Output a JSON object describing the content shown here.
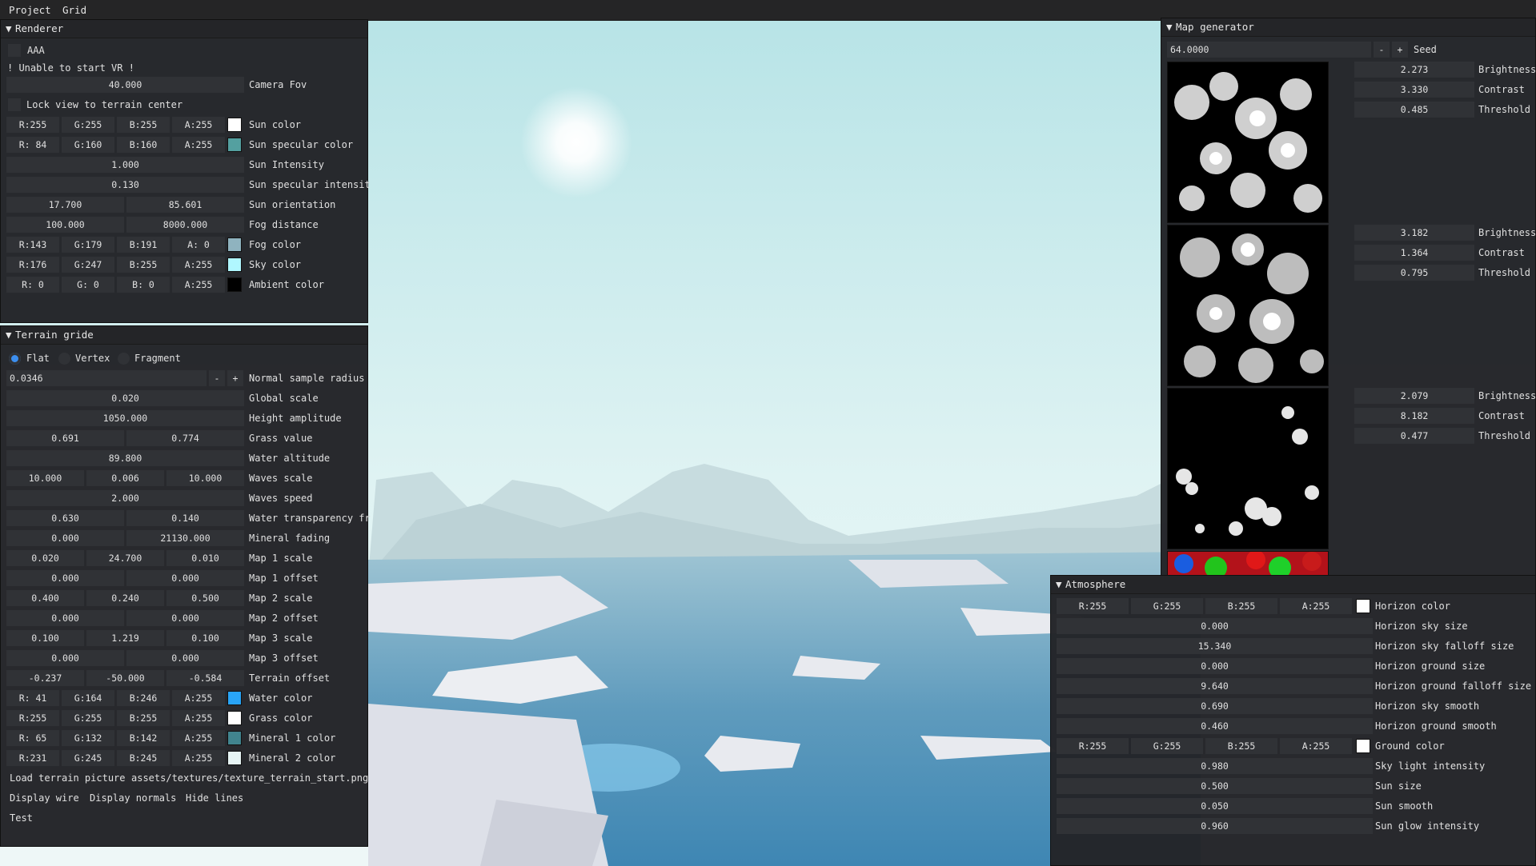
{
  "menu": {
    "items": [
      "Project",
      "Grid"
    ]
  },
  "renderer": {
    "title": "Renderer",
    "aa_label": "AAA",
    "vr_warning": "! Unable to start VR !",
    "camera_fov": {
      "value": "40.000",
      "label": "Camera Fov"
    },
    "lock_view_label": "Lock view to terrain center",
    "sun_color": {
      "r": "R:255",
      "g": "G:255",
      "b": "B:255",
      "a": "A:255",
      "label": "Sun color",
      "hex": "#ffffff"
    },
    "sun_specular_color": {
      "r": "R: 84",
      "g": "G:160",
      "b": "B:160",
      "a": "A:255",
      "label": "Sun specular color",
      "hex": "#54a0a0"
    },
    "sun_intensity": {
      "value": "1.000",
      "label": "Sun Intensity"
    },
    "sun_specular_intensity": {
      "value": "0.130",
      "label": "Sun specular intensit"
    },
    "sun_orientation": {
      "v1": "17.700",
      "v2": "85.601",
      "label": "Sun orientation"
    },
    "fog_distance": {
      "v1": "100.000",
      "v2": "8000.000",
      "label": "Fog distance"
    },
    "fog_color": {
      "r": "R:143",
      "g": "G:179",
      "b": "B:191",
      "a": "A:  0",
      "label": "Fog color",
      "hex": "#8fb3bf"
    },
    "sky_color": {
      "r": "R:176",
      "g": "G:247",
      "b": "B:255",
      "a": "A:255",
      "label": "Sky color",
      "hex": "#b0f7ff"
    },
    "ambient_color": {
      "r": "R:  0",
      "g": "G:  0",
      "b": "B:  0",
      "a": "A:255",
      "label": "Ambient color",
      "hex": "#000000"
    }
  },
  "terrain": {
    "title": "Terrain gride",
    "shading": {
      "options": [
        "Flat",
        "Vertex",
        "Fragment"
      ],
      "selected": "Flat"
    },
    "normal_sample_radius": {
      "value": "0.0346",
      "minus": "-",
      "plus": "+",
      "label": "Normal sample radius"
    },
    "global_scale": {
      "value": "0.020",
      "label": "Global scale"
    },
    "height_amplitude": {
      "value": "1050.000",
      "label": "Height amplitude"
    },
    "grass_value": {
      "v1": "0.691",
      "v2": "0.774",
      "label": "Grass value"
    },
    "water_altitude": {
      "value": "89.800",
      "label": "Water altitude"
    },
    "waves_scale": {
      "v1": "10.000",
      "v2": "0.006",
      "v3": "10.000",
      "label": "Waves scale"
    },
    "waves_speed": {
      "value": "2.000",
      "label": "Waves speed"
    },
    "water_transparency": {
      "v1": "0.630",
      "v2": "0.140",
      "label": "Water transparency fr"
    },
    "mineral_fading": {
      "v1": "0.000",
      "v2": "21130.000",
      "label": "Mineral fading"
    },
    "map1_scale": {
      "v1": "0.020",
      "v2": "24.700",
      "v3": "0.010",
      "label": "Map 1 scale"
    },
    "map1_offset": {
      "v1": "0.000",
      "v2": "0.000",
      "label": "Map 1 offset"
    },
    "map2_scale": {
      "v1": "0.400",
      "v2": "0.240",
      "v3": "0.500",
      "label": "Map 2 scale"
    },
    "map2_offset": {
      "v1": "0.000",
      "v2": "0.000",
      "label": "Map 2 offset"
    },
    "map3_scale": {
      "v1": "0.100",
      "v2": "1.219",
      "v3": "0.100",
      "label": "Map 3 scale"
    },
    "map3_offset": {
      "v1": "0.000",
      "v2": "0.000",
      "label": "Map 3 offset"
    },
    "terrain_offset": {
      "v1": "-0.237",
      "v2": "-50.000",
      "v3": "-0.584",
      "label": "Terrain offset"
    },
    "water_color": {
      "r": "R: 41",
      "g": "G:164",
      "b": "B:246",
      "a": "A:255",
      "label": "Water color",
      "hex": "#29a4f6"
    },
    "grass_color": {
      "r": "R:255",
      "g": "G:255",
      "b": "B:255",
      "a": "A:255",
      "label": "Grass color",
      "hex": "#ffffff"
    },
    "mineral1_color": {
      "r": "R: 65",
      "g": "G:132",
      "b": "B:142",
      "a": "A:255",
      "label": "Mineral 1 color",
      "hex": "#41848e"
    },
    "mineral2_color": {
      "r": "R:231",
      "g": "G:245",
      "b": "B:245",
      "a": "A:255",
      "label": "Mineral 2 color",
      "hex": "#e7f5f5"
    },
    "load_picture_label": "Load terrain picture",
    "picture_path": "assets/textures/texture_terrain_start.png",
    "display_wire": "Display wire",
    "display_normals": "Display normals",
    "hide_lines": "Hide lines",
    "test": "Test"
  },
  "map_generator": {
    "title": "Map generator",
    "seed": {
      "value": "64.0000",
      "minus": "-",
      "plus": "+",
      "label": "Seed"
    },
    "maps": [
      {
        "brightness": "2.273",
        "contrast": "3.330",
        "threshold": "0.485"
      },
      {
        "brightness": "3.182",
        "contrast": "1.364",
        "threshold": "0.795"
      },
      {
        "brightness": "2.079",
        "contrast": "8.182",
        "threshold": "0.477"
      }
    ],
    "labels": {
      "brightness": "Brightness",
      "contrast": "Contrast",
      "threshold": "Threshold"
    }
  },
  "atmosphere": {
    "title": "Atmosphere",
    "horizon_color": {
      "r": "R:255",
      "g": "G:255",
      "b": "B:255",
      "a": "A:255",
      "label": "Horizon color",
      "hex": "#ffffff"
    },
    "horizon_sky_size": {
      "value": "0.000",
      "label": "Horizon sky size"
    },
    "horizon_sky_falloff": {
      "value": "15.340",
      "label": "Horizon sky falloff size"
    },
    "horizon_ground_size": {
      "value": "0.000",
      "label": "Horizon ground size"
    },
    "horizon_ground_falloff": {
      "value": "9.640",
      "label": "Horizon ground falloff size"
    },
    "horizon_sky_smooth": {
      "value": "0.690",
      "label": "Horizon sky smooth"
    },
    "horizon_ground_smooth": {
      "value": "0.460",
      "label": "Horizon ground smooth"
    },
    "ground_color": {
      "r": "R:255",
      "g": "G:255",
      "b": "B:255",
      "a": "A:255",
      "label": "Ground color",
      "hex": "#ffffff"
    },
    "sky_light_intensity": {
      "value": "0.980",
      "label": "Sky light intensity"
    },
    "sun_size": {
      "value": "0.500",
      "label": "Sun size"
    },
    "sun_smooth": {
      "value": "0.050",
      "label": "Sun smooth"
    },
    "sun_glow_intensity": {
      "value": "0.960",
      "label": "Sun glow intensity"
    }
  }
}
